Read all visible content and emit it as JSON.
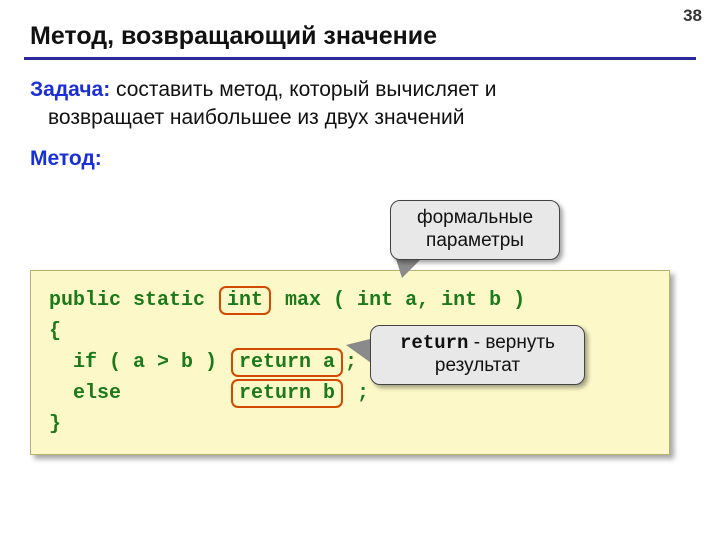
{
  "page_number": "38",
  "title": "Метод, возвращающий значение",
  "task": {
    "label": "Задача:",
    "text1": " составить метод, который вычисляет и",
    "text2": "возвращает наибольшее из двух значений"
  },
  "method_label": "Метод:",
  "callout1": {
    "line1": "формальные",
    "line2": "параметры"
  },
  "callout2": {
    "mono": "return",
    "text1": " - вернуть",
    "text2": "результат"
  },
  "code": {
    "l1a": "public static ",
    "l1_hl": "int",
    "l1b": " max ( int a, int b )",
    "l2": "{",
    "l3a": "  if ( a > b ) ",
    "l3_hl": "return a",
    "l3b": ";",
    "l4a": "  else         ",
    "l4_hl": "return b",
    "l4b": " ;",
    "l5": "}"
  }
}
